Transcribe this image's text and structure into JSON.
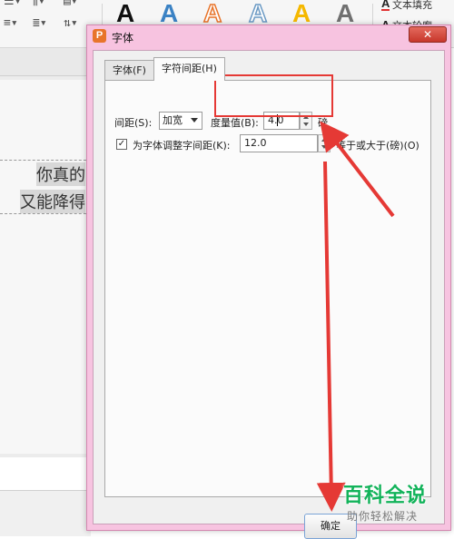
{
  "background_app": {
    "ribbon": {
      "wordart_letter": "A",
      "wordart_colors": [
        "#111111",
        "#3b82c4",
        "#e8742a",
        "#6b9ac4",
        "#f5b800",
        "#707070"
      ],
      "text_fill_label": "文本填充",
      "text_outline_label": "文本轮廓"
    },
    "slide_text": {
      "line1": "你真的",
      "line2": "又能降得"
    }
  },
  "dialog": {
    "title": "字体",
    "app_logo": "P",
    "close_symbol": "✕",
    "tabs": [
      {
        "label": "字体(F)",
        "active": false
      },
      {
        "label": "字符间距(H)",
        "active": true
      }
    ],
    "spacing": {
      "label": "间距(S):",
      "selected": "加宽",
      "measure_label": "度量值(B):",
      "measure_value": "4.0",
      "unit": "磅"
    },
    "kerning": {
      "checked": true,
      "check_mark": "✓",
      "label": "为字体调整字间距(K):",
      "value": "12.0",
      "suffix": "等于或大于(磅)(O)"
    },
    "ok_button": "确定"
  },
  "watermark": {
    "main": "百科全说",
    "sub": "助你轻松解决"
  },
  "colors": {
    "dialog_frame": "#f7c3e0",
    "annotation_red": "#e53935",
    "watermark_green": "#12b35a"
  }
}
